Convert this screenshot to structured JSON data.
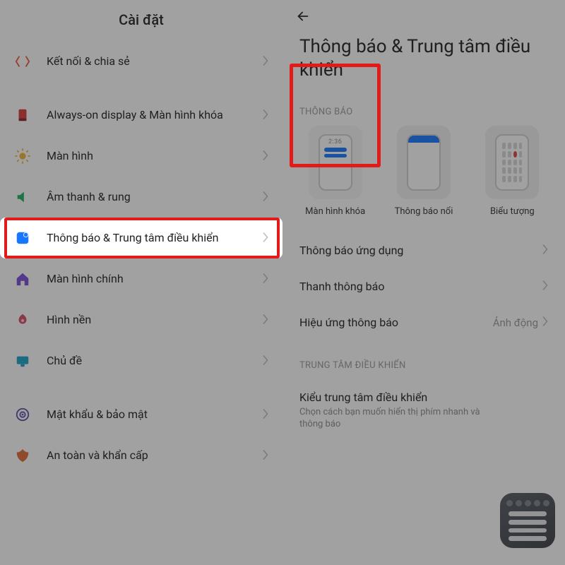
{
  "left": {
    "title": "Cài đặt",
    "items": [
      {
        "key": "connect",
        "label": "Kết nối & chia sẻ",
        "iconColor": "#ee5a33"
      },
      {
        "gap": true
      },
      {
        "key": "aod",
        "label": "Always-on display & Màn hình khóa",
        "iconColor": "#d83a3a"
      },
      {
        "key": "display",
        "label": "Màn hình",
        "iconColor": "#f2b63a"
      },
      {
        "key": "sound",
        "label": "Âm thanh & rung",
        "iconColor": "#1fae5e"
      },
      {
        "key": "notif",
        "label": "Thông báo & Trung tâm điều khiển",
        "iconColor": "#1677ff",
        "highlight": true
      },
      {
        "key": "home",
        "label": "Màn hình chính",
        "iconColor": "#7a4dd8"
      },
      {
        "key": "wall",
        "label": "Hình nền",
        "iconColor": "#d84a6a"
      },
      {
        "key": "theme",
        "label": "Chủ đề",
        "iconColor": "#1aa3c9"
      },
      {
        "gap": true
      },
      {
        "key": "sec",
        "label": "Mật khẩu & bảo mật",
        "iconColor": "#5a4da6"
      },
      {
        "key": "safe",
        "label": "An toàn và khẩn cấp",
        "iconColor": "#e06b3a"
      }
    ]
  },
  "right": {
    "title": "Thông báo & Trung tâm điều khiển",
    "section1": "THÔNG BÁO",
    "cards": [
      {
        "key": "lock",
        "label": "Màn hình khóa",
        "selected": true,
        "time": "2:36"
      },
      {
        "key": "float",
        "label": "Thông báo nổi"
      },
      {
        "key": "badge",
        "label": "Biểu tượng"
      }
    ],
    "rows": [
      {
        "key": "appnotif",
        "label": "Thông báo ứng dụng"
      },
      {
        "key": "bar",
        "label": "Thanh thông báo"
      },
      {
        "key": "effect",
        "label": "Hiệu ứng thông báo",
        "value": "Ảnh động"
      }
    ],
    "section2": "TRUNG TÂM ĐIỀU KHIỂN",
    "ccTitle": "Kiểu trung tâm điều khiển",
    "ccSub": "Chọn cách bạn muốn hiển thị phím nhanh và thông báo"
  }
}
